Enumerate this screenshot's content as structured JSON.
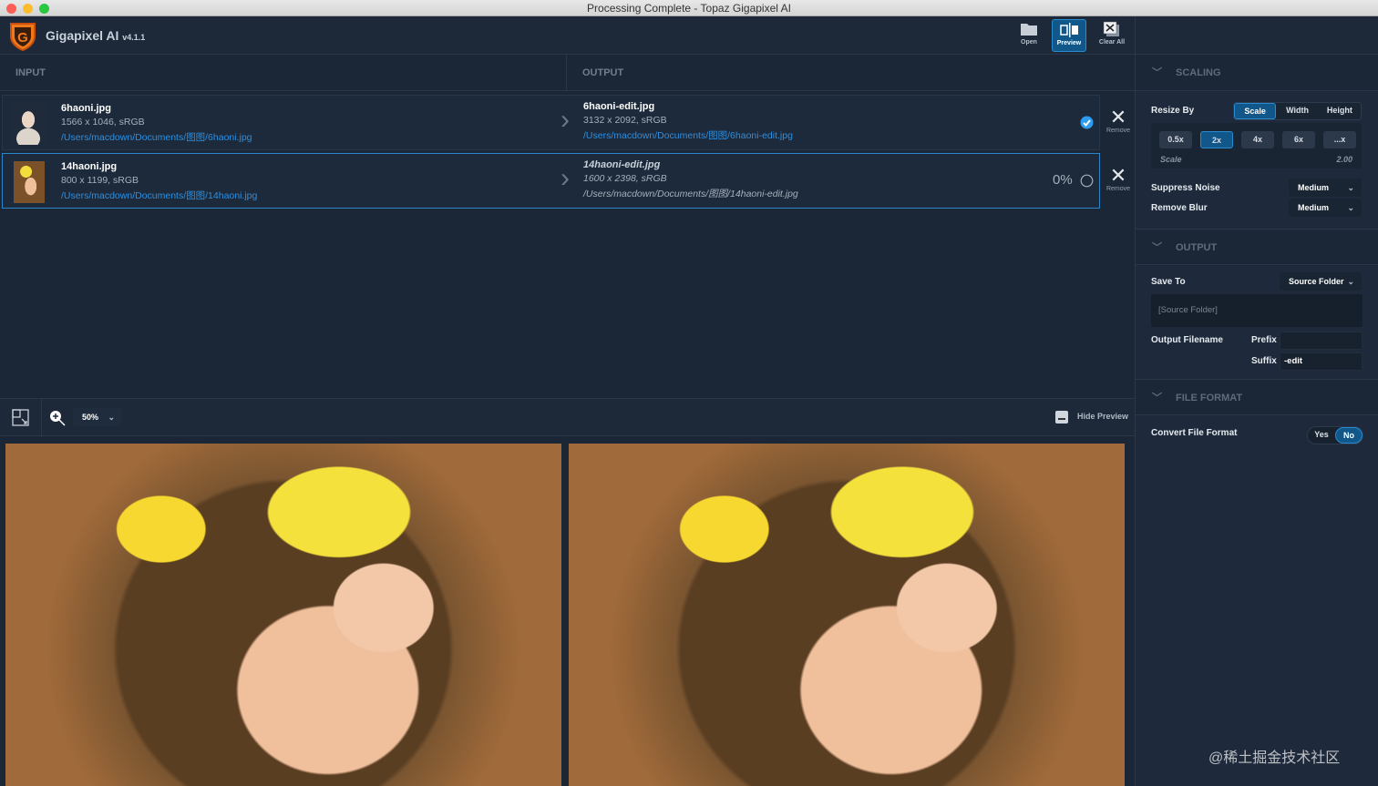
{
  "window": {
    "title": "Processing Complete - Topaz Gigapixel AI"
  },
  "app": {
    "name": "Gigapixel AI",
    "version": "v4.1.1",
    "logo_letter": "G"
  },
  "toolbar": {
    "open": "Open",
    "preview": "Preview",
    "clear_all": "Clear All"
  },
  "columns": {
    "input": "INPUT",
    "output": "OUTPUT"
  },
  "files": [
    {
      "input_name": "6haoni.jpg",
      "input_meta": "1566 x 1046, sRGB",
      "input_path": "/Users/macdown/Documents/图图/6haoni.jpg",
      "output_name": "6haoni-edit.jpg",
      "output_meta": "3132 x 2092, sRGB",
      "output_path": "/Users/macdown/Documents/图图/6haoni-edit.jpg",
      "status": "complete",
      "progress": "",
      "remove": "Remove"
    },
    {
      "input_name": "14haoni.jpg",
      "input_meta": "800 x 1199, sRGB",
      "input_path": "/Users/macdown/Documents/图图/14haoni.jpg",
      "output_name": "14haoni-edit.jpg",
      "output_meta": "1600 x 2398, sRGB",
      "output_path": "/Users/macdown/Documents/图图/14haoni-edit.jpg",
      "status": "pending",
      "progress": "0%",
      "remove": "Remove"
    }
  ],
  "preview": {
    "zoom": "50%",
    "hide_preview": "Hide Preview"
  },
  "scaling": {
    "title": "SCALING",
    "resize_by": "Resize By",
    "modes": [
      "Scale",
      "Width",
      "Height"
    ],
    "active_mode": "Scale",
    "scales": [
      "0.5x",
      "2x",
      "4x",
      "6x",
      "...x"
    ],
    "active_scale": "2x",
    "scale_label": "Scale",
    "scale_value": "2.00",
    "suppress_noise": "Suppress Noise",
    "suppress_noise_value": "Medium",
    "remove_blur": "Remove Blur",
    "remove_blur_value": "Medium"
  },
  "output": {
    "title": "OUTPUT",
    "save_to": "Save To",
    "save_to_value": "Source Folder",
    "folder_path": "[Source Folder]",
    "output_filename": "Output Filename",
    "prefix_label": "Prefix",
    "prefix_value": "",
    "suffix_label": "Suffix",
    "suffix_value": "-edit"
  },
  "file_format": {
    "title": "FILE FORMAT",
    "convert": "Convert File Format",
    "yes": "Yes",
    "no": "No",
    "selected": "No"
  },
  "watermark": "@稀土掘金技术社区",
  "colors": {
    "accent": "#11578a",
    "link": "#2d8fe0",
    "bg": "#1b2636"
  }
}
